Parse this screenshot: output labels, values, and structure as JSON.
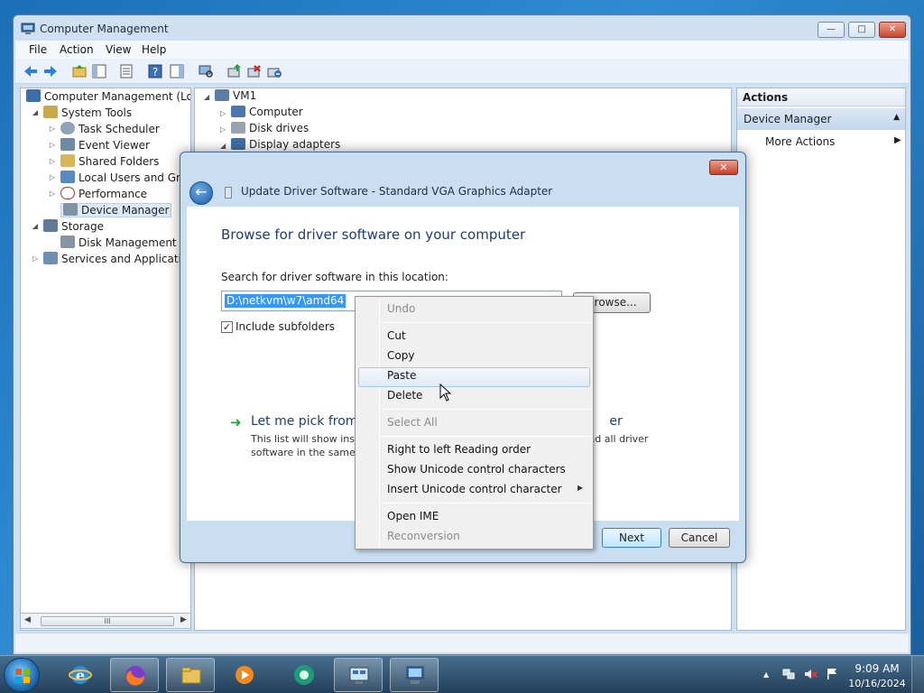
{
  "window": {
    "title": "Computer Management",
    "buttons": {
      "minimize": "—",
      "maximize": "□",
      "close": "✕"
    }
  },
  "menu": [
    "File",
    "Action",
    "View",
    "Help"
  ],
  "toolbar_icons": [
    "back-arrow-icon",
    "forward-arrow-icon",
    "up-folder-icon",
    "show-hide-tree-icon",
    "properties-icon",
    "help-icon",
    "show-hide-action-pane-icon",
    "scan-hardware-icon",
    "update-driver-icon",
    "uninstall-icon",
    "disable-device-icon"
  ],
  "tree": {
    "root": "Computer Management (Local",
    "items": [
      {
        "label": "System Tools",
        "icon": "tools-icon"
      },
      {
        "label": "Task Scheduler",
        "icon": "clock-icon"
      },
      {
        "label": "Event Viewer",
        "icon": "event-viewer-icon"
      },
      {
        "label": "Shared Folders",
        "icon": "shared-folder-icon"
      },
      {
        "label": "Local Users and Group",
        "icon": "users-icon"
      },
      {
        "label": "Performance",
        "icon": "performance-icon"
      },
      {
        "label": "Device Manager",
        "icon": "device-manager-icon"
      },
      {
        "label": "Storage",
        "icon": "storage-icon"
      },
      {
        "label": "Disk Management",
        "icon": "disk-icon"
      },
      {
        "label": "Services and Applications",
        "icon": "services-icon"
      }
    ],
    "scroll_thumb": "III"
  },
  "devices": {
    "root": "VM1",
    "items": [
      "Computer",
      "Disk drives",
      "Display adapters"
    ]
  },
  "actions": {
    "header": "Actions",
    "section": "Device Manager",
    "more": "More Actions"
  },
  "dialog": {
    "title": "Update Driver Software - Standard VGA Graphics Adapter",
    "heading": "Browse for driver software on your computer",
    "search_label": "Search for driver software in this location:",
    "path_value": "D:\\netkvm\\w7\\amd64",
    "browse_label": "Browse...",
    "include_subfolders": "Include subfolders",
    "include_checked": true,
    "pick_title": "Let me pick from",
    "pick_title_tail": "er",
    "pick_desc1": "This list will show inst",
    "pick_desc1_tail": "nd all driver",
    "pick_desc2": "software in the same c",
    "next_label": "Next",
    "cancel_label": "Cancel"
  },
  "context_menu": {
    "undo": "Undo",
    "cut": "Cut",
    "copy": "Copy",
    "paste": "Paste",
    "delete": "Delete",
    "select_all": "Select All",
    "rtl": "Right to left Reading order",
    "show_unicode": "Show Unicode control characters",
    "insert_unicode": "Insert Unicode control character",
    "open_ime": "Open IME",
    "reconversion": "Reconversion",
    "hovered": "Paste"
  },
  "taskbar": {
    "apps": [
      "internet-explorer-icon",
      "firefox-icon",
      "file-explorer-icon",
      "media-player-icon",
      "chrome-like-icon",
      "remote-desktop-icon",
      "computer-management-icon"
    ],
    "time": "9:09 AM",
    "date": "10/16/2024"
  },
  "colors": {
    "accent": "#1e3d73",
    "selection": "#3399ff",
    "taskbar": "#2f5270"
  }
}
